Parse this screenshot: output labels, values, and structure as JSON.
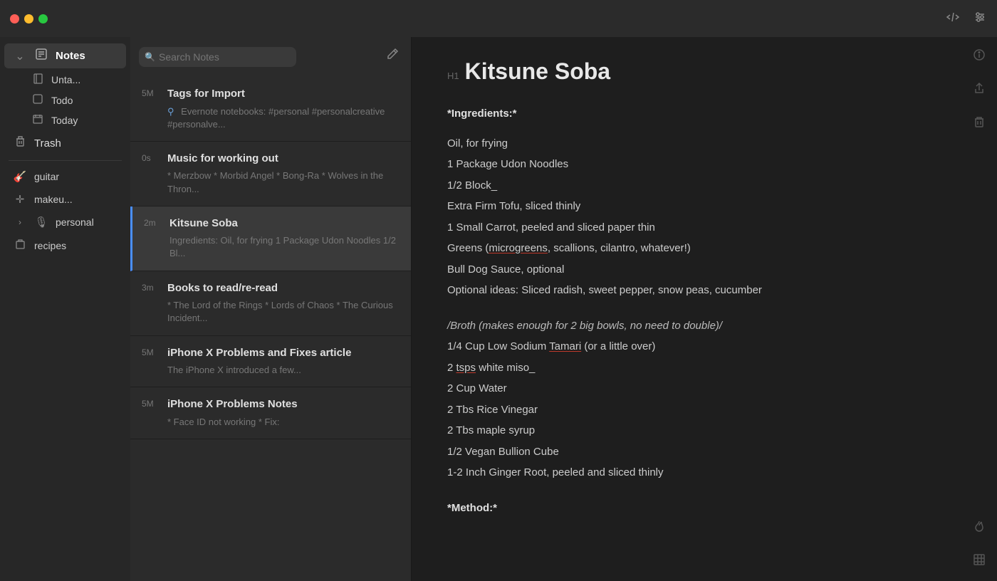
{
  "titlebar": {
    "icons": {
      "code": "⌨",
      "settings": "⚙"
    }
  },
  "sidebar": {
    "notes_label": "Notes",
    "chevron": "⌄",
    "sub_items": [
      {
        "label": "Unta...",
        "icon": "□"
      },
      {
        "label": "Todo",
        "icon": "□"
      },
      {
        "label": "Today",
        "icon": "📅"
      }
    ],
    "trash_label": "Trash",
    "groups": [
      {
        "label": "guitar",
        "icon": "🎸"
      },
      {
        "label": "makeu...",
        "icon": "✚"
      },
      {
        "label": "personal",
        "icon": "🎙"
      },
      {
        "label": "recipes",
        "icon": "🗑"
      }
    ],
    "expand_icon": "›"
  },
  "search": {
    "placeholder": "Search Notes"
  },
  "note_list": {
    "items": [
      {
        "time": "5M",
        "title": "Tags for Import",
        "preview": "Evernote notebooks: #personal #personalcreative #personalve...",
        "has_icon": true,
        "active": false
      },
      {
        "time": "0s",
        "title": "Music for working out",
        "preview": "* Merzbow * Morbid Angel * Bong-Ra * Wolves in the Thron...",
        "has_icon": false,
        "active": false
      },
      {
        "time": "2m",
        "title": "Kitsune Soba",
        "preview": "Ingredients: Oil, for frying 1 Package Udon Noodles 1/2 Bl...",
        "has_icon": false,
        "active": true
      },
      {
        "time": "3m",
        "title": "Books to read/re-read",
        "preview": "* The Lord of the Rings * Lords of Chaos * The Curious Incident...",
        "has_icon": false,
        "active": false
      },
      {
        "time": "5M",
        "title": "iPhone X Problems and Fixes article",
        "preview": "The iPhone X introduced a few...",
        "has_icon": false,
        "active": false
      },
      {
        "time": "5M",
        "title": "iPhone X Problems Notes",
        "preview": "* Face ID not working * Fix:",
        "has_icon": false,
        "active": false
      }
    ]
  },
  "editor": {
    "heading_marker": "H1",
    "title": "Kitsune Soba",
    "content": {
      "ingredients_label": "*Ingredients:*",
      "ingredients": [
        "Oil, for frying",
        "1 Package Udon Noodles",
        "1/2 Block_",
        "Extra Firm Tofu, sliced thinly",
        "1 Small Carrot, peeled and sliced paper thin",
        "Greens (microgreens, scallions, cilantro, whatever!)",
        "Bull Dog Sauce, optional",
        "Optional ideas: Sliced radish, sweet pepper, snow peas, cucumber"
      ],
      "broth_label": "/Broth (makes enough for 2 big bowls, no need to double)/",
      "broth": [
        "1/4 Cup Low Sodium Tamari (or a little over)",
        "2 tsps white miso_",
        "2 Cup Water",
        "2 Tbs Rice Vinegar",
        "2 Tbs maple syrup",
        "1/2 Vegan Bullion Cube",
        "1-2 Inch Ginger Root, peeled and sliced thinly"
      ],
      "method_label": "*Method:*"
    }
  }
}
